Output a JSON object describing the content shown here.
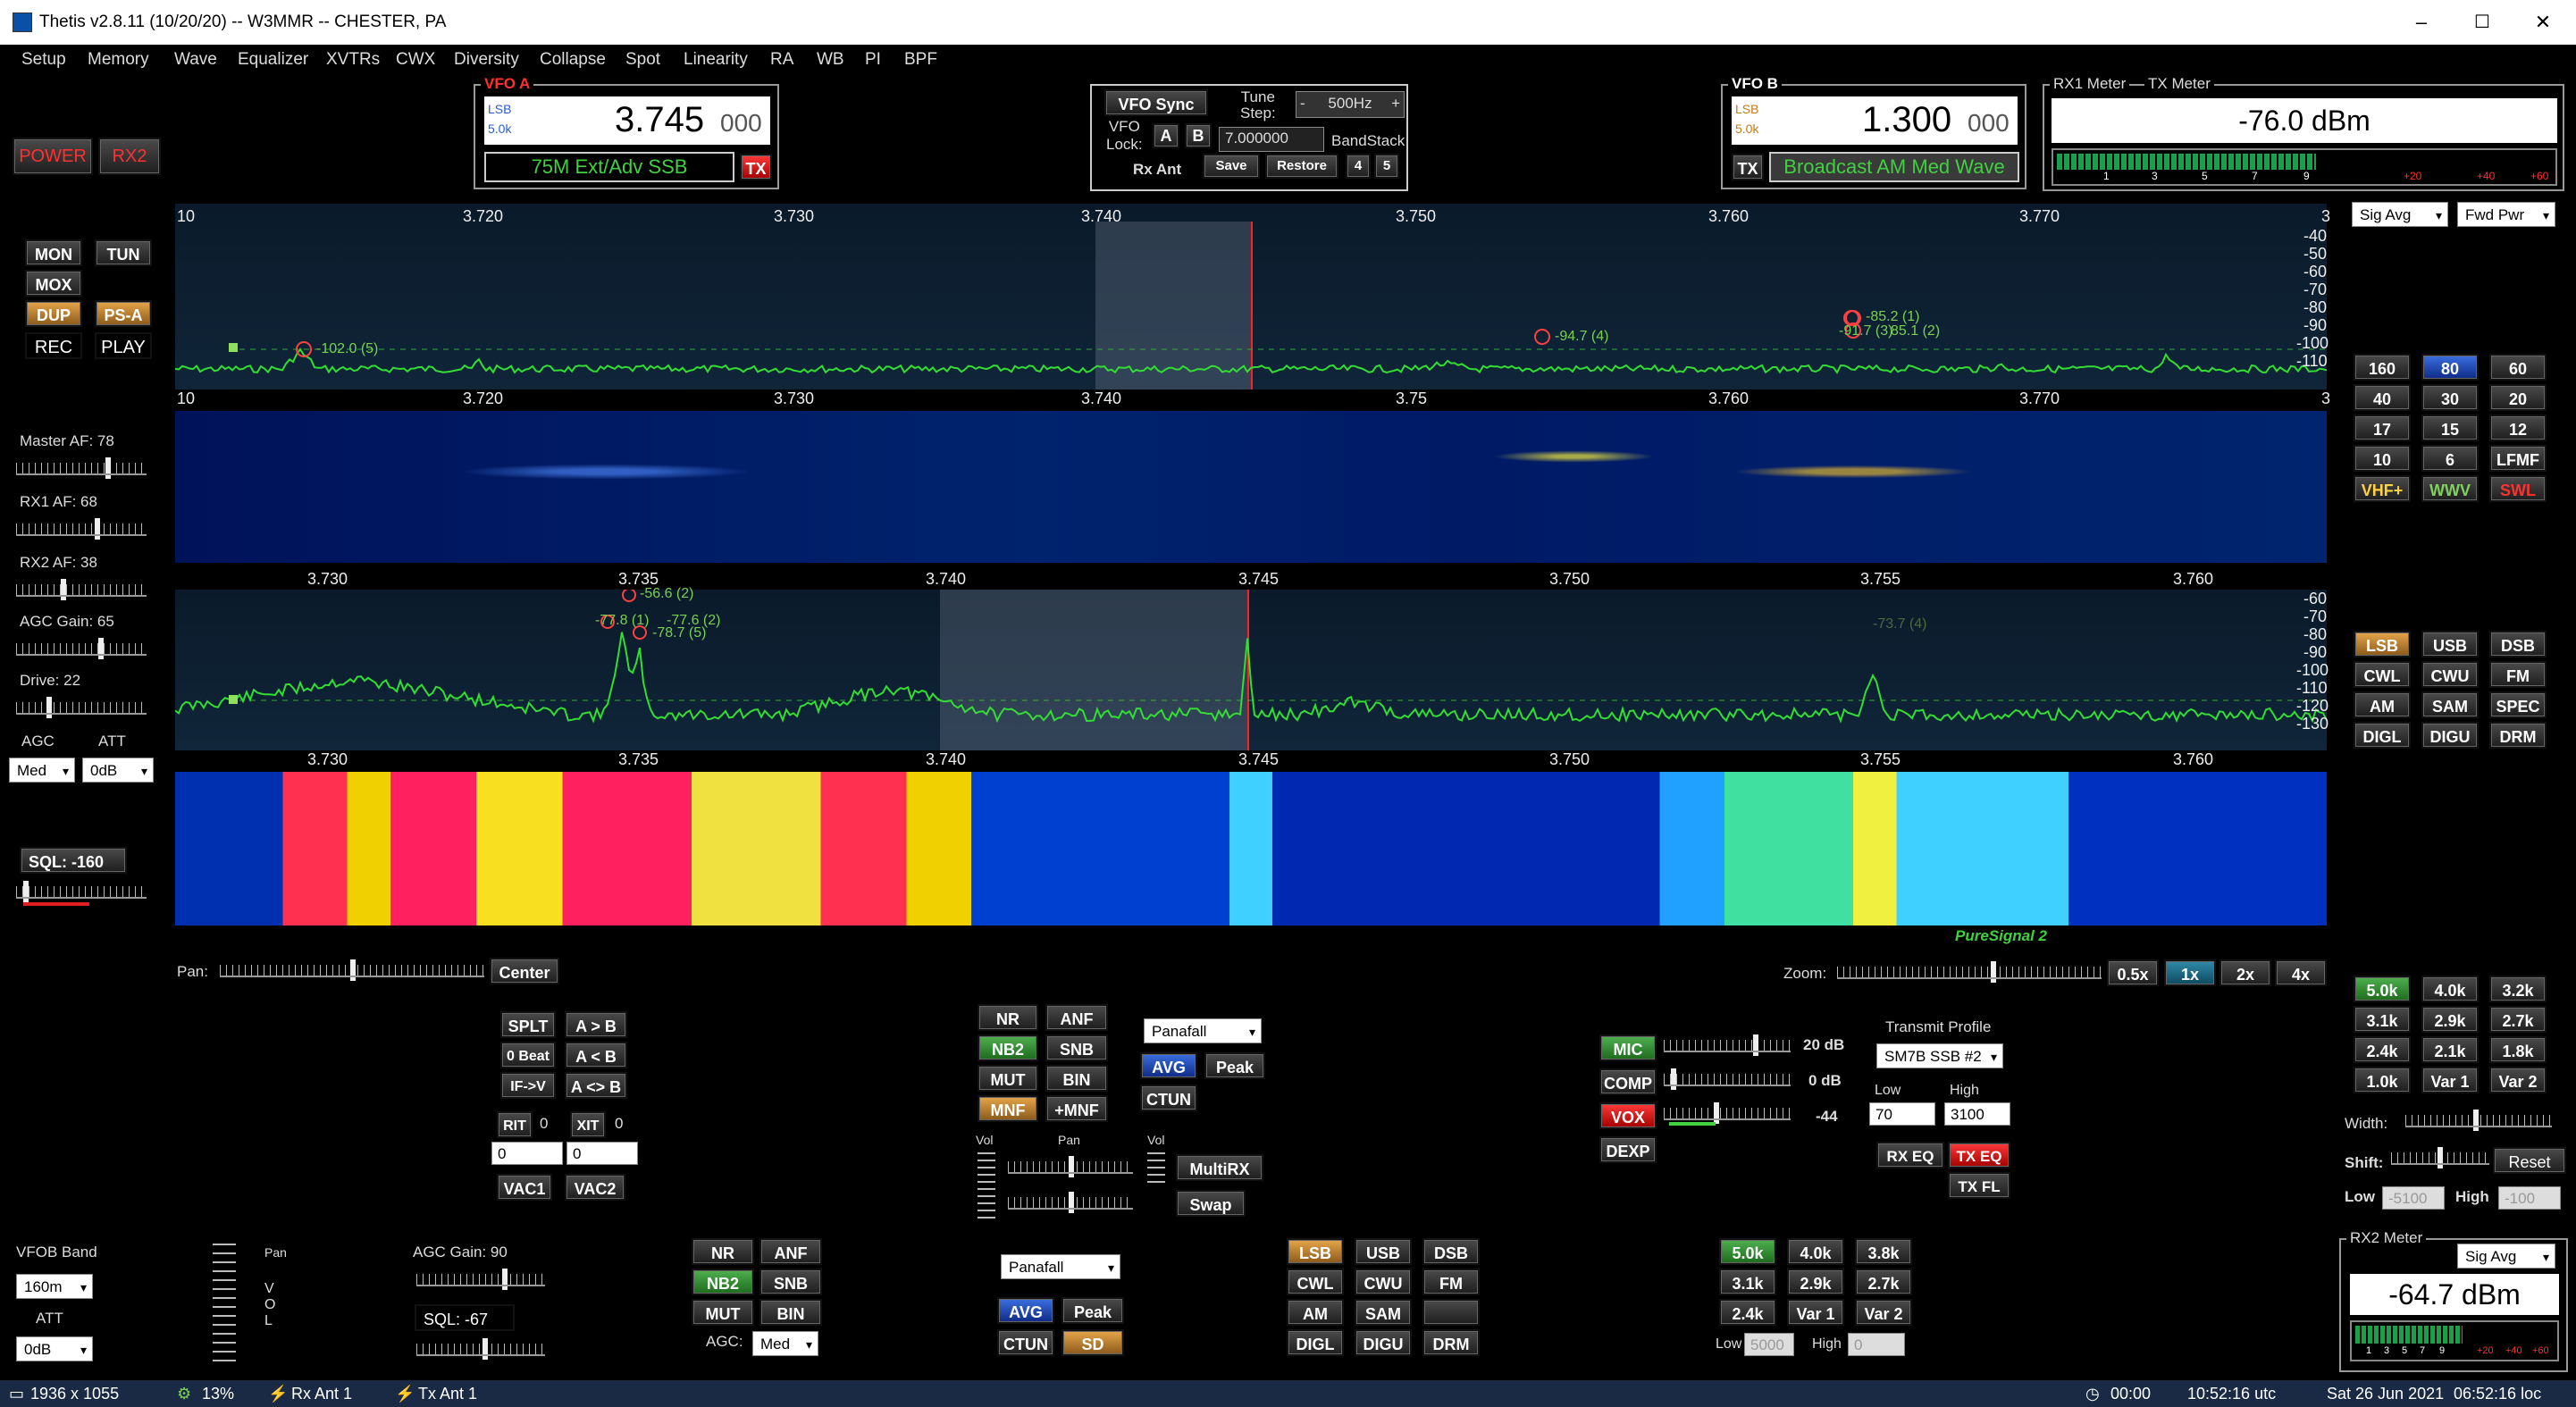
{
  "window": {
    "title": "Thetis v2.8.11 (10/20/20)  --  W3MMR  --  CHESTER, PA",
    "minimize": "–",
    "maximize": "☐",
    "close": "✕"
  },
  "menu": [
    "Setup",
    "Memory",
    "Wave",
    "Equalizer",
    "XVTRs",
    "CWX",
    "Diversity",
    "Collapse",
    "Spot",
    "Linearity",
    "RA",
    "WB",
    "PI",
    "BPF"
  ],
  "power": {
    "power": "POWER",
    "rx2": "RX2"
  },
  "vfoa": {
    "title": "VFO A",
    "mode": "LSB",
    "filter": "5.0k",
    "freq": "3.745",
    "freq_small": "000",
    "band_label": "75M Ext/Adv SSB",
    "tx": "TX"
  },
  "vfob": {
    "title": "VFO B",
    "mode": "LSB",
    "filter": "5.0k",
    "freq": "1.300",
    "freq_small": "000",
    "band_label": "Broadcast AM Med Wave",
    "tx": "TX"
  },
  "vfocenter": {
    "vfo_sync": "VFO Sync",
    "tune_step_label": "Tune\nStep:",
    "tune_step": "500Hz",
    "vfo_lock": "VFO\nLock:",
    "a": "A",
    "b": "B",
    "lock_value": "7.000000",
    "bandstack": "BandStack",
    "rx_ant": "Rx Ant",
    "save": "Save",
    "restore": "Restore",
    "bs4": "4",
    "bs5": "5"
  },
  "meter": {
    "rx1": "RX1 Meter",
    "tx": "TX Meter",
    "value": "-76.0 dBm",
    "sel1": "Sig Avg",
    "sel2": "Fwd Pwr",
    "scale": [
      "1",
      "3",
      "5",
      "7",
      "9",
      "+20",
      "+40",
      "+60"
    ]
  },
  "rx2meter": {
    "title": "RX2 Meter",
    "sel": "Sig Avg",
    "value": "-64.7 dBm",
    "scale": [
      "1",
      "3",
      "5",
      "7",
      "9",
      "+20",
      "+40",
      "+60"
    ]
  },
  "left": {
    "mon": "MON",
    "tun": "TUN",
    "mox": "MOX",
    "dup": "DUP",
    "ps": "PS-A",
    "rec": "REC",
    "play": "PLAY",
    "master_af": "Master AF:  78",
    "rx1_af": "RX1 AF:  68",
    "rx2_af": "RX2 AF:  38",
    "agc_gain": "AGC Gain:  65",
    "drive": "Drive:  22",
    "agc": "AGC",
    "att": "ATT",
    "agc_val": "Med",
    "att_val": "0dB",
    "sql": "SQL:  -160"
  },
  "spec1": {
    "ticks": [
      "10",
      "3.720",
      "3.730",
      "3.740",
      "3.750",
      "3.760",
      "3.770",
      "3"
    ],
    "db": [
      "-40",
      "-50",
      "-60",
      "-70",
      "-80",
      "-90",
      "-100",
      "-110"
    ],
    "spots": [
      "-102.0 (5)",
      "-94.7 (4)",
      "-85.2 (1)",
      "-91.7 (3)",
      "85.1 (2)"
    ]
  },
  "wf1": {
    "ticks": [
      "10",
      "3.720",
      "3.730",
      "3.740",
      "3.75",
      "3.760",
      "3.770",
      "3"
    ]
  },
  "spec2": {
    "ticks": [
      "3.730",
      "3.735",
      "3.740",
      "3.745",
      "3.750",
      "3.755",
      "3.760"
    ],
    "db": [
      "-60",
      "-70",
      "-80",
      "-90",
      "-100",
      "-110",
      "-120",
      "-130"
    ],
    "spots": [
      "-56.6 (2)",
      "-77.8 (1)",
      "-77.6 (2)",
      "-78.7 (5)",
      "-73.7 (4)"
    ]
  },
  "wf2": {
    "ticks": [
      "3.730",
      "3.735",
      "3.740",
      "3.745",
      "3.750",
      "3.755",
      "3.760"
    ]
  },
  "bands": [
    "160",
    "80",
    "60",
    "40",
    "30",
    "20",
    "17",
    "15",
    "12",
    "10",
    "6",
    "LFMF",
    "VHF+",
    "WWV",
    "SWL"
  ],
  "modes": [
    "LSB",
    "USB",
    "DSB",
    "CWL",
    "CWU",
    "FM",
    "AM",
    "SAM",
    "SPEC",
    "DIGL",
    "DIGU",
    "DRM"
  ],
  "filters": [
    "5.0k",
    "4.0k",
    "3.2k",
    "3.1k",
    "2.9k",
    "2.7k",
    "2.4k",
    "2.1k",
    "1.8k",
    "1.0k",
    "Var 1",
    "Var 2"
  ],
  "filterctl": {
    "width": "Width:",
    "shift": "Shift:",
    "reset": "Reset",
    "low": "Low",
    "high": "High",
    "low_val": "-5100",
    "high_val": "-100"
  },
  "pan": {
    "pan": "Pan:",
    "center": "Center",
    "zoom": "Zoom:",
    "z05": "0.5x",
    "z1": "1x",
    "z2": "2x",
    "z4": "4x",
    "puresignal": "PureSignal 2"
  },
  "vfoctl": {
    "splt": "SPLT",
    "a2b": "A > B",
    "zerobeat": "0 Beat",
    "b2a": "A < B",
    "if2v": "IF->V",
    "swapab": "A <> B",
    "rit": "RIT",
    "rit_v": "0",
    "xit": "XIT",
    "xit_v": "0",
    "rit_num": "0",
    "xit_num": "0",
    "vac1": "VAC1",
    "vac2": "VAC2"
  },
  "dsp1": {
    "nr": "NR",
    "anf": "ANF",
    "nb2": "NB2",
    "snb": "SNB",
    "mut": "MUT",
    "bin": "BIN",
    "mnf": "MNF",
    "pmnf": "+MNF",
    "display": "Panafall",
    "avg": "AVG",
    "peak": "Peak",
    "ctun": "CTUN",
    "vol": "Vol",
    "pan": "Pan",
    "vol2": "Vol",
    "multirx": "MultiRX",
    "swap": "Swap"
  },
  "tx": {
    "mic": "MIC",
    "mic_db": "20 dB",
    "comp": "COMP",
    "comp_db": "0 dB",
    "vox": "VOX",
    "vox_db": "-44",
    "dexp": "DEXP",
    "profile_lbl": "Transmit Profile",
    "profile": "SM7B SSB #2",
    "low": "Low",
    "high": "High",
    "low_v": "70",
    "high_v": "3100",
    "rxeq": "RX EQ",
    "txeq": "TX EQ",
    "txfl": "TX FL"
  },
  "rx2": {
    "vfob_band": "VFOB Band",
    "band": "160m",
    "att": "ATT",
    "att_v": "0dB",
    "pan": "Pan",
    "vol": "V\nO\nL",
    "agc_gain": "AGC Gain:  90",
    "sql": "SQL:  -67",
    "nr": "NR",
    "anf": "ANF",
    "nb2": "NB2",
    "snb": "SNB",
    "mut": "MUT",
    "bin": "BIN",
    "agc": "AGC:",
    "agc_v": "Med",
    "display": "Panafall",
    "avg": "AVG",
    "peak": "Peak",
    "ctun": "CTUN",
    "sd": "SD",
    "modes": [
      "LSB",
      "USB",
      "DSB",
      "CWL",
      "CWU",
      "FM",
      "AM",
      "SAM",
      "",
      "DIGL",
      "DIGU",
      "DRM"
    ],
    "filters": [
      "5.0k",
      "4.0k",
      "3.8k",
      "3.1k",
      "2.9k",
      "2.7k",
      "2.4k",
      "Var 1",
      "Var 2"
    ],
    "low": "Low",
    "high": "High",
    "low_v": "5000",
    "high_v": "0"
  },
  "status": {
    "res": "1936 x 1055",
    "cpu": "13%",
    "rxant": "Rx Ant 1",
    "txant": "Tx Ant 1",
    "timer": "00:00",
    "utc": "10:52:16 utc",
    "date": "Sat 26 Jun 2021",
    "loc": "06:52:16 loc"
  },
  "colors": {
    "trace": "#33dd33",
    "accent_red": "#ff2020",
    "accent_green": "#3fae3f",
    "accent_orange": "#e09a3a",
    "accent_blue": "#2456d0"
  }
}
